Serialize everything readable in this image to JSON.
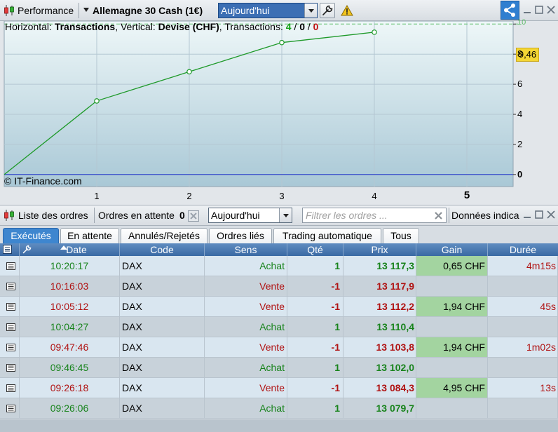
{
  "top_toolbar": {
    "performance_label": "Performance",
    "instrument": "Allemagne 30 Cash (1€)",
    "period": "Aujourd'hui"
  },
  "chart": {
    "caption_prefix": "Horizontal: ",
    "caption_horizontal": "Transactions",
    "caption_mid": ", Vertical: ",
    "caption_vertical": "Devise (CHF)",
    "caption_tx": ", Transactions: ",
    "tx_green": "4",
    "tx_sep1": " / ",
    "tx_zero": "0",
    "tx_sep2": " / ",
    "tx_red": "0",
    "copyright": "© IT-Finance.com",
    "last_value_label": "9,46"
  },
  "chart_data": {
    "type": "line",
    "x": [
      0,
      1,
      2,
      3,
      4
    ],
    "y": [
      0,
      4.89,
      6.83,
      8.77,
      9.46
    ],
    "x_ticks": [
      "1",
      "2",
      "3",
      "4",
      "5"
    ],
    "y_ticks": [
      "0",
      "2",
      "4",
      "6",
      "8",
      "10"
    ],
    "xlim": [
      0,
      5.5
    ],
    "ylim": [
      -0.8,
      10.2
    ],
    "grid": true,
    "line_color": "#1f9a2a",
    "zero_line_color": "#2336c8",
    "target_line_value": 10
  },
  "orders_toolbar": {
    "list_label": "Liste des ordres",
    "pending_label": "Ordres en attente",
    "pending_count": "0",
    "period": "Aujourd'hui",
    "filter_placeholder": "Filtrer les ordres ...",
    "data_label": "Données indica"
  },
  "tabs": [
    {
      "label": "Exécutés"
    },
    {
      "label": "En attente"
    },
    {
      "label": "Annulés/Rejetés"
    },
    {
      "label": "Ordres liés"
    },
    {
      "label": "Trading automatique"
    },
    {
      "label": "Tous"
    }
  ],
  "table": {
    "headers": {
      "date": "Date",
      "code": "Code",
      "sens": "Sens",
      "qte": "Qté",
      "prix": "Prix",
      "gain": "Gain",
      "duree": "Durée"
    },
    "rows": [
      {
        "date": "10:20:17",
        "code": "DAX",
        "sens": "Achat",
        "qte": "1",
        "prix": "13 117,3",
        "gain": "0,65 CHF",
        "duree": "4m15s",
        "side": "buy"
      },
      {
        "date": "10:16:03",
        "code": "DAX",
        "sens": "Vente",
        "qte": "-1",
        "prix": "13 117,9",
        "gain": "",
        "duree": "",
        "side": "sell"
      },
      {
        "date": "10:05:12",
        "code": "DAX",
        "sens": "Vente",
        "qte": "-1",
        "prix": "13 112,2",
        "gain": "1,94 CHF",
        "duree": "45s",
        "side": "sell"
      },
      {
        "date": "10:04:27",
        "code": "DAX",
        "sens": "Achat",
        "qte": "1",
        "prix": "13 110,4",
        "gain": "",
        "duree": "",
        "side": "buy"
      },
      {
        "date": "09:47:46",
        "code": "DAX",
        "sens": "Vente",
        "qte": "-1",
        "prix": "13 103,8",
        "gain": "1,94 CHF",
        "duree": "1m02s",
        "side": "sell"
      },
      {
        "date": "09:46:45",
        "code": "DAX",
        "sens": "Achat",
        "qte": "1",
        "prix": "13 102,0",
        "gain": "",
        "duree": "",
        "side": "buy"
      },
      {
        "date": "09:26:18",
        "code": "DAX",
        "sens": "Vente",
        "qte": "-1",
        "prix": "13 084,3",
        "gain": "4,95 CHF",
        "duree": "13s",
        "side": "sell"
      },
      {
        "date": "09:26:06",
        "code": "DAX",
        "sens": "Achat",
        "qte": "1",
        "prix": "13 079,7",
        "gain": "",
        "duree": "",
        "side": "buy"
      }
    ]
  }
}
